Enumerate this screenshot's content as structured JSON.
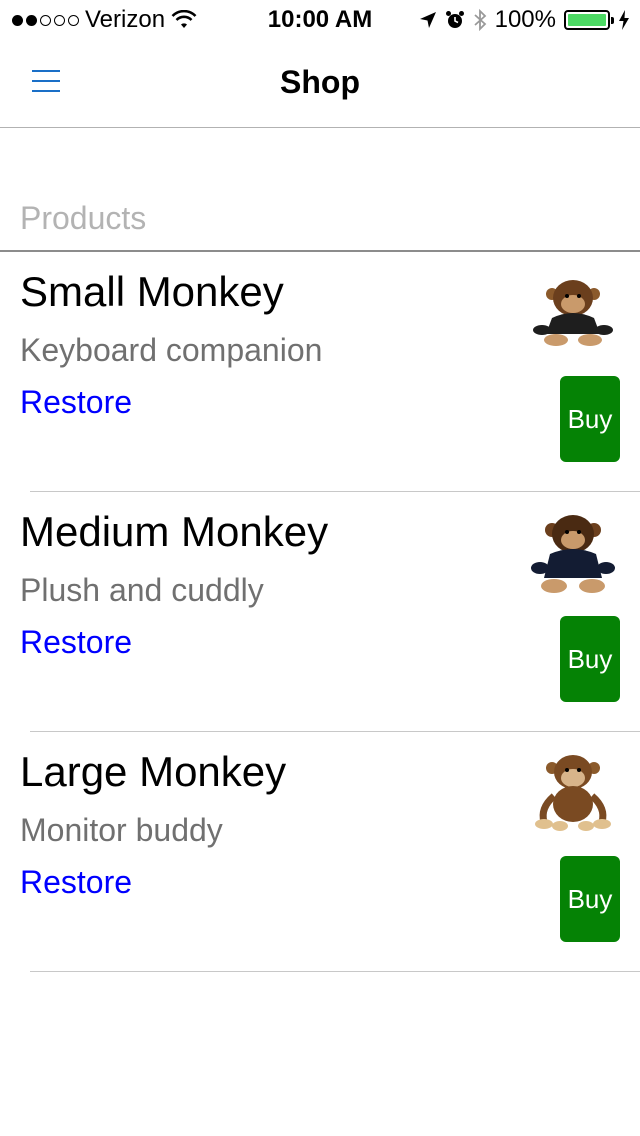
{
  "status_bar": {
    "carrier": "Verizon",
    "signal_bars_filled": 2,
    "signal_bars_total": 5,
    "time": "10:00 AM",
    "battery_percent": "100%",
    "battery_level": 1.0,
    "battery_color": "#4cd964",
    "icons": [
      "wifi-icon",
      "location-arrow-icon",
      "alarm-clock-icon",
      "bluetooth-icon",
      "battery-icon",
      "charging-bolt-icon"
    ]
  },
  "navbar": {
    "title": "Shop",
    "menu_icon": "hamburger-menu-icon",
    "accent_color": "#1a6fc7"
  },
  "section": {
    "title": "Products"
  },
  "products": [
    {
      "name": "Small Monkey",
      "description": "Keyboard companion",
      "restore_label": "Restore",
      "buy_label": "Buy",
      "image": "small-monkey-plush-image"
    },
    {
      "name": "Medium Monkey",
      "description": "Plush and cuddly",
      "restore_label": "Restore",
      "buy_label": "Buy",
      "image": "medium-monkey-plush-image"
    },
    {
      "name": "Large Monkey",
      "description": "Monitor buddy",
      "restore_label": "Restore",
      "buy_label": "Buy",
      "image": "large-monkey-plush-image"
    }
  ],
  "colors": {
    "buy_button": "#058205",
    "restore_link": "#0000ff",
    "secondary_text": "#707070",
    "section_header_text": "#b3b3b3"
  }
}
